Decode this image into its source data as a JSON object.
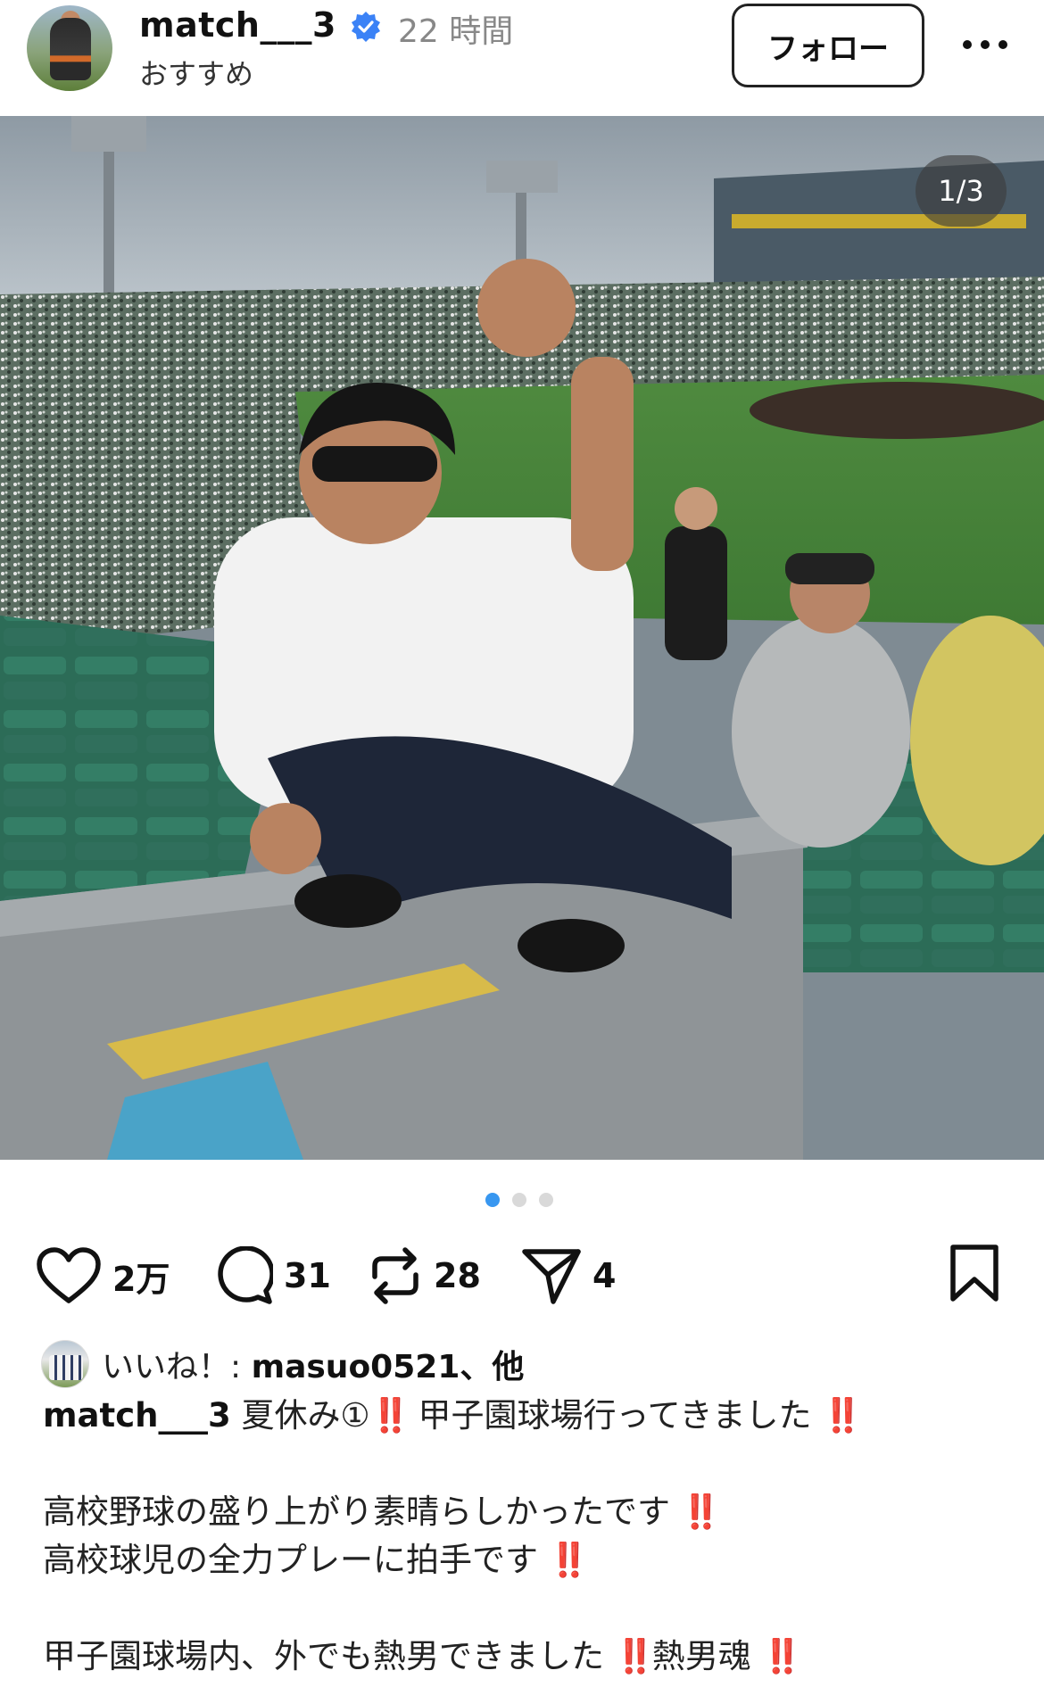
{
  "header": {
    "username": "match___3",
    "time": "22 時間",
    "subtitle": "おすすめ",
    "follow_label": "フォロー"
  },
  "post": {
    "photo_counter": "1/3",
    "photo_description_icon": "stadium-photo",
    "carousel": {
      "total": 3,
      "active_index": 0
    }
  },
  "actions": {
    "like_count": "2万",
    "comment_count": "31",
    "repost_count": "28",
    "share_count": "4"
  },
  "likes": {
    "prefix": "いいね！: ",
    "user": "masuo0521",
    "suffix": "、他"
  },
  "caption": {
    "username": "match___3",
    "line1": "夏休み①",
    "line1b": "甲子園球場行ってきました",
    "line2": "高校野球の盛り上がり素晴らしかったです",
    "line3": "高校球児の全力プレーに拍手です",
    "line4": "甲子園球場内、外でも熱男できました",
    "line4b": "熱男魂",
    "emphasis": "‼️"
  },
  "colors": {
    "accent_blue": "#3897f0",
    "verified_blue": "#3b82f6",
    "emphasis_red": "#d3131a"
  }
}
